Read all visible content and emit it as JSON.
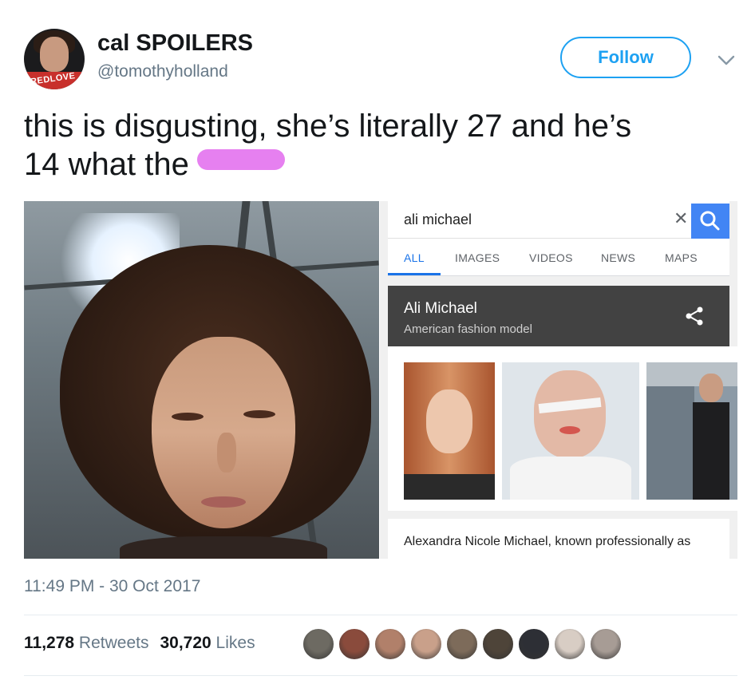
{
  "tweet": {
    "display_name": "cal SPOILERS",
    "handle": "@tomothyholland",
    "follow_label": "Follow",
    "text_line1": "this is disgusting, she’s literally 27 and he’s",
    "text_line2": "14 what the",
    "avatar_shirt_text": "REDLOVE",
    "timestamp": "11:49 PM - 30 Oct 2017",
    "retweets_count": "11,278",
    "retweets_label": "Retweets",
    "likes_count": "30,720",
    "likes_label": "Likes"
  },
  "google_panel": {
    "query": "ali michael",
    "clear_icon": "close-icon",
    "search_icon": "search-icon",
    "tabs": [
      {
        "label": "ALL",
        "active": true
      },
      {
        "label": "IMAGES",
        "active": false
      },
      {
        "label": "VIDEOS",
        "active": false
      },
      {
        "label": "NEWS",
        "active": false
      },
      {
        "label": "MAPS",
        "active": false
      }
    ],
    "entity_name": "Ali Michael",
    "entity_subtitle": "American fashion model",
    "share_icon": "share-icon",
    "description": "Alexandra Nicole Michael, known professionally as"
  },
  "colors": {
    "twitter_blue": "#1da1f2",
    "google_blue": "#4285f4",
    "censor_pink": "#e680f0",
    "kp_header_bg": "#424242",
    "muted_text": "#657786"
  },
  "likers": [
    {
      "name": "liker-avatar-1",
      "color": "#6d6a62"
    },
    {
      "name": "liker-avatar-2",
      "color": "#8a4b3c"
    },
    {
      "name": "liker-avatar-3",
      "color": "#b1806a"
    },
    {
      "name": "liker-avatar-4",
      "color": "#c9a08a"
    },
    {
      "name": "liker-avatar-5",
      "color": "#7d6b5a"
    },
    {
      "name": "liker-avatar-6",
      "color": "#4e4439"
    },
    {
      "name": "liker-avatar-7",
      "color": "#2d2f35"
    },
    {
      "name": "liker-avatar-8",
      "color": "#d8cdc4"
    },
    {
      "name": "liker-avatar-9",
      "color": "#a79c95"
    }
  ]
}
